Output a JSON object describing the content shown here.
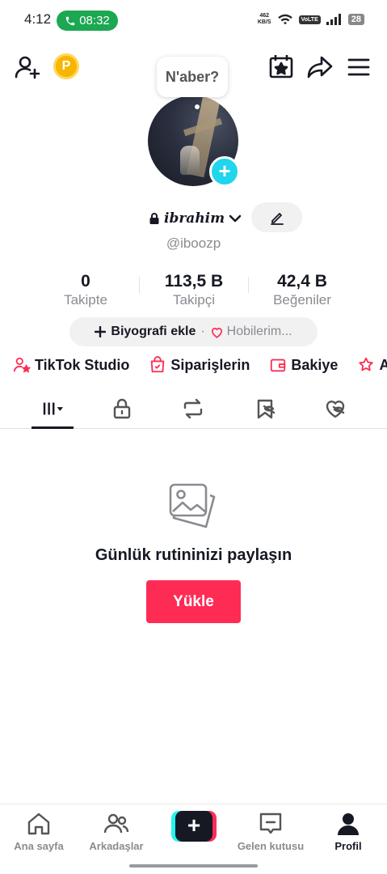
{
  "status_bar": {
    "time": "4:12",
    "call_time": "08:32",
    "net_speed_value": "462",
    "net_speed_unit": "KB/S",
    "volte": "VoLTE",
    "battery": "28"
  },
  "profile": {
    "bubble_text": "N'aber?",
    "username": "ibrahim",
    "handle": "@iboozp",
    "bio_add_label": "Biyografi ekle",
    "bio_separator": "·",
    "hobbies_label": "Hobilerim..."
  },
  "stats": [
    {
      "value": "0",
      "label": "Takipte"
    },
    {
      "value": "113,5 B",
      "label": "Takipçi"
    },
    {
      "value": "42,4 B",
      "label": "Beğeniler"
    }
  ],
  "shortcuts": [
    {
      "label": "TikTok Studio",
      "icon": "person-star-icon"
    },
    {
      "label": "Siparişlerin",
      "icon": "shopping-bag-icon"
    },
    {
      "label": "Bakiye",
      "icon": "wallet-icon"
    },
    {
      "label": "A",
      "icon": "gift-star-icon"
    }
  ],
  "empty_state": {
    "title": "Günlük rutininizi paylaşın",
    "button": "Yükle"
  },
  "bottom_nav": [
    {
      "label": "Ana sayfa",
      "icon": "home-icon"
    },
    {
      "label": "Arkadaşlar",
      "icon": "friends-icon"
    },
    {
      "label": "Gelen kutusu",
      "icon": "inbox-icon"
    },
    {
      "label": "Profil",
      "icon": "profile-icon"
    }
  ],
  "colors": {
    "accent": "#fe2c55",
    "cyan": "#20d5ec",
    "call_green": "#1ca752",
    "coin": "#f7b500"
  }
}
